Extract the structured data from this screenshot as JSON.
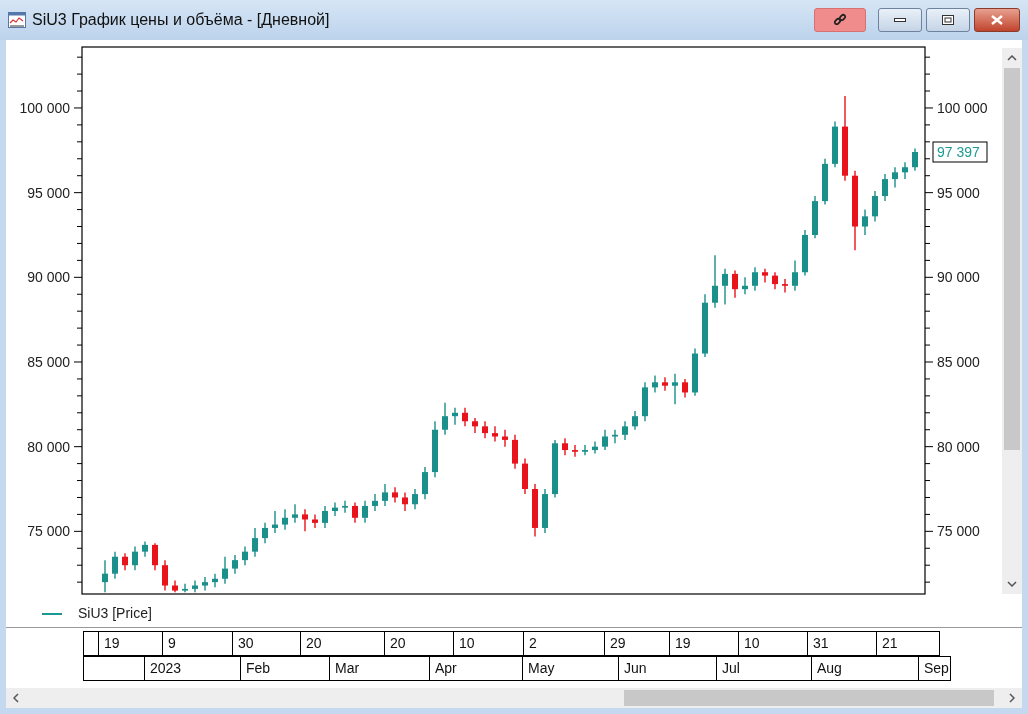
{
  "window": {
    "title": "SiU3 График цены и объёма - [Дневной]"
  },
  "chart": {
    "chart_data": {
      "type": "candlestick",
      "ylim": [
        71300,
        103600
      ],
      "categories": [
        null,
        null,
        null,
        null,
        null,
        null,
        null,
        null,
        null,
        null,
        null,
        null,
        null,
        null,
        null,
        null,
        null,
        null,
        null,
        null,
        null,
        null,
        null,
        null,
        null,
        null,
        null,
        null,
        null,
        null,
        null,
        null,
        null,
        null,
        null,
        null,
        null,
        null,
        null,
        null,
        null,
        null,
        null,
        null,
        null,
        null,
        null,
        null,
        null,
        null,
        null,
        null,
        null,
        null,
        null,
        null,
        null,
        null,
        null,
        null,
        null,
        null,
        null,
        null,
        null,
        null,
        null,
        null,
        null,
        null,
        null,
        null,
        null,
        null,
        null,
        null,
        null,
        null,
        null,
        null,
        null,
        null
      ],
      "ohlc": [
        [
          72000,
          73300,
          71400,
          72500
        ],
        [
          72500,
          73800,
          72200,
          73500
        ],
        [
          73500,
          73700,
          72700,
          73000
        ],
        [
          73000,
          74100,
          72700,
          73800
        ],
        [
          73800,
          74400,
          73500,
          74200
        ],
        [
          74200,
          74300,
          72700,
          73000
        ],
        [
          73000,
          73300,
          71500,
          71800
        ],
        [
          71800,
          72100,
          71400,
          71500
        ],
        [
          71500,
          71900,
          71400,
          71600
        ],
        [
          71600,
          72100,
          71400,
          71800
        ],
        [
          71800,
          72300,
          71500,
          72000
        ],
        [
          72000,
          72500,
          71700,
          72200
        ],
        [
          72200,
          73500,
          71900,
          72800
        ],
        [
          72800,
          73600,
          72500,
          73300
        ],
        [
          73300,
          74100,
          73000,
          73800
        ],
        [
          73800,
          75200,
          73500,
          74600
        ],
        [
          74600,
          75500,
          74300,
          75200
        ],
        [
          75200,
          76200,
          74900,
          75400
        ],
        [
          75400,
          76300,
          75100,
          75800
        ],
        [
          75800,
          76600,
          75500,
          76000
        ],
        [
          76000,
          76300,
          75000,
          75700
        ],
        [
          75700,
          76000,
          75200,
          75500
        ],
        [
          75500,
          76500,
          75200,
          76200
        ],
        [
          76200,
          76700,
          75900,
          76400
        ],
        [
          76400,
          76800,
          76100,
          76500
        ],
        [
          76500,
          76700,
          75500,
          75800
        ],
        [
          75800,
          76800,
          75500,
          76500
        ],
        [
          76500,
          77200,
          76200,
          76800
        ],
        [
          76800,
          77800,
          76500,
          77300
        ],
        [
          77300,
          77600,
          76700,
          77000
        ],
        [
          77000,
          77300,
          76200,
          76600
        ],
        [
          76600,
          77500,
          76300,
          77200
        ],
        [
          77200,
          78800,
          76900,
          78500
        ],
        [
          78500,
          81500,
          78200,
          81000
        ],
        [
          81000,
          82600,
          80700,
          81800
        ],
        [
          81800,
          82300,
          81300,
          82000
        ],
        [
          82000,
          82300,
          81200,
          81500
        ],
        [
          81500,
          81700,
          80800,
          81200
        ],
        [
          81200,
          81500,
          80500,
          80800
        ],
        [
          80800,
          81200,
          80300,
          80600
        ],
        [
          80600,
          81000,
          80000,
          80400
        ],
        [
          80400,
          80700,
          78700,
          79000
        ],
        [
          79000,
          79300,
          77200,
          77500
        ],
        [
          77500,
          77800,
          74700,
          75200
        ],
        [
          75200,
          77500,
          74900,
          77200
        ],
        [
          77200,
          80400,
          77000,
          80200
        ],
        [
          80200,
          80500,
          79500,
          79800
        ],
        [
          79800,
          80100,
          79400,
          79700
        ],
        [
          79700,
          80100,
          79500,
          79800
        ],
        [
          79800,
          80300,
          79600,
          80000
        ],
        [
          80000,
          81000,
          79800,
          80600
        ],
        [
          80600,
          81000,
          80200,
          80700
        ],
        [
          80700,
          81500,
          80400,
          81200
        ],
        [
          81200,
          82100,
          81000,
          81800
        ],
        [
          81800,
          83800,
          81500,
          83500
        ],
        [
          83500,
          84200,
          83200,
          83800
        ],
        [
          83800,
          84100,
          83300,
          83600
        ],
        [
          83600,
          84300,
          82500,
          83800
        ],
        [
          83800,
          84000,
          82900,
          83200
        ],
        [
          83200,
          85800,
          83000,
          85500
        ],
        [
          85500,
          89000,
          85300,
          88500
        ],
        [
          88500,
          91300,
          88200,
          89500
        ],
        [
          89500,
          90500,
          88400,
          90200
        ],
        [
          90200,
          90400,
          88800,
          89300
        ],
        [
          89300,
          90000,
          89000,
          89500
        ],
        [
          89500,
          90600,
          89200,
          90300
        ],
        [
          90300,
          90500,
          89700,
          90100
        ],
        [
          90100,
          90300,
          89300,
          89600
        ],
        [
          89600,
          89900,
          89100,
          89500
        ],
        [
          89500,
          91000,
          89200,
          90300
        ],
        [
          90300,
          92800,
          90100,
          92500
        ],
        [
          92500,
          94800,
          92300,
          94500
        ],
        [
          94500,
          97000,
          94300,
          96700
        ],
        [
          96700,
          99200,
          96500,
          98900
        ],
        [
          98900,
          100700,
          95700,
          96000
        ],
        [
          96000,
          96300,
          91600,
          93000
        ],
        [
          93000,
          94000,
          92500,
          93600
        ],
        [
          93600,
          95100,
          93300,
          94800
        ],
        [
          94800,
          96100,
          94500,
          95800
        ],
        [
          95800,
          96500,
          95300,
          96200
        ],
        [
          96200,
          96800,
          95800,
          96500
        ],
        [
          96500,
          97600,
          96300,
          97400
        ]
      ],
      "yticks": [
        {
          "value": 75000,
          "label": "75 000"
        },
        {
          "value": 80000,
          "label": "80 000"
        },
        {
          "value": 85000,
          "label": "85 000"
        },
        {
          "value": 90000,
          "label": "90 000"
        },
        {
          "value": 95000,
          "label": "95 000"
        },
        {
          "value": 100000,
          "label": "100 000"
        }
      ]
    },
    "right_axis_labels": [
      "100 000",
      "95 000",
      "90 000",
      "85 000",
      "80 000",
      "75 000"
    ],
    "last_price": "97 397"
  },
  "legend": [
    {
      "label": "SiU3 [Price]"
    }
  ],
  "time_axis": {
    "days": [
      "19",
      "9",
      "30",
      "20",
      "20",
      "10",
      "2",
      "29",
      "19",
      "10",
      "31",
      "21"
    ],
    "months": [
      "2023",
      "Feb",
      "Mar",
      "Apr",
      "May",
      "Jun",
      "Jul",
      "Aug",
      "Sep"
    ]
  }
}
